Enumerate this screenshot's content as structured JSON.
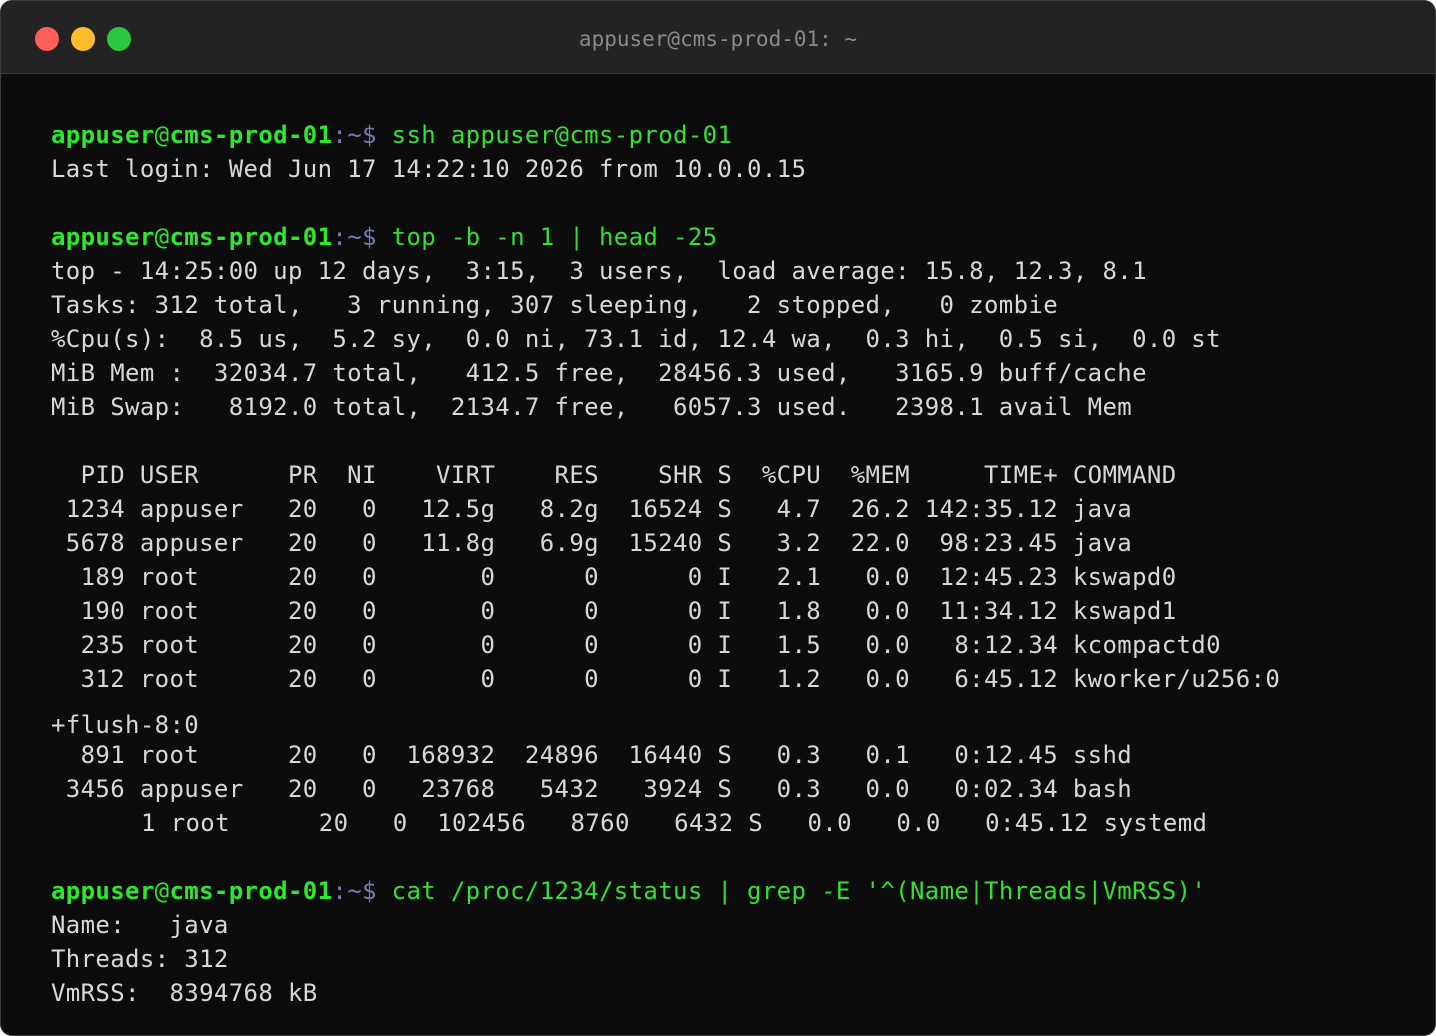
{
  "window": {
    "title": "appuser@cms-prod-01: ~"
  },
  "prompt": {
    "user": "appuser",
    "at": "@",
    "host": "cms-prod-01",
    "sep": ":~$ "
  },
  "session": {
    "cmd1": "ssh appuser@cms-prod-01",
    "last_login": "Last login: Wed Jun 17 14:22:10 2026 from 10.0.0.15",
    "cmd2": "top -b -n 1 | head -25",
    "top_header": [
      "top - 14:25:00 up 12 days,  3:15,  3 users,  load average: 15.8, 12.3, 8.1",
      "Tasks: 312 total,   3 running, 307 sleeping,   2 stopped,   0 zombie",
      "%Cpu(s):  8.5 us,  5.2 sy,  0.0 ni, 73.1 id, 12.4 wa,  0.3 hi,  0.5 si,  0.0 st",
      "MiB Mem :  32034.7 total,   412.5 free,  28456.3 used,   3165.9 buff/cache",
      "MiB Swap:   8192.0 total,  2134.7 free,   6057.3 used.   2398.1 avail Mem"
    ],
    "table_header": "  PID USER      PR  NI    VIRT    RES    SHR S  %CPU  %MEM     TIME+ COMMAND",
    "table_rows": [
      " 1234 appuser   20   0   12.5g   8.2g  16524 S   4.7  26.2 142:35.12 java",
      " 5678 appuser   20   0   11.8g   6.9g  15240 S   3.2  22.0  98:23.45 java",
      "  189 root      20   0       0      0      0 I   2.1   0.0  12:45.23 kswapd0",
      "  190 root      20   0       0      0      0 I   1.8   0.0  11:34.12 kswapd1",
      "  235 root      20   0       0      0      0 I   1.5   0.0   8:12.34 kcompactd0",
      "  312 root      20   0       0      0      0 I   1.2   0.0   6:45.12 kworker/u256:0"
    ],
    "wrapped": "+flush-8:0",
    "table_rows_2": [
      "  891 root      20   0  168932  24896  16440 S   0.3   0.1   0:12.45 sshd",
      " 3456 appuser   20   0   23768   5432   3924 S   0.3   0.0   0:02.34 bash",
      "     1 root      20   0  102456   8760   6432 S   0.0   0.0   0:45.12 systemd"
    ],
    "cmd3": "cat /proc/1234/status | grep -E '^(Name|Threads|VmRSS)'",
    "status_lines": [
      "Name:   java",
      "Threads: 312",
      "VmRSS:  8394768 kB"
    ]
  },
  "colors": {
    "background": "#0c0c0c",
    "titlebar": "#232323",
    "prompt_green": "#2ee62e",
    "prompt_sep": "#6f7fb0",
    "text": "#d8d8d8"
  }
}
